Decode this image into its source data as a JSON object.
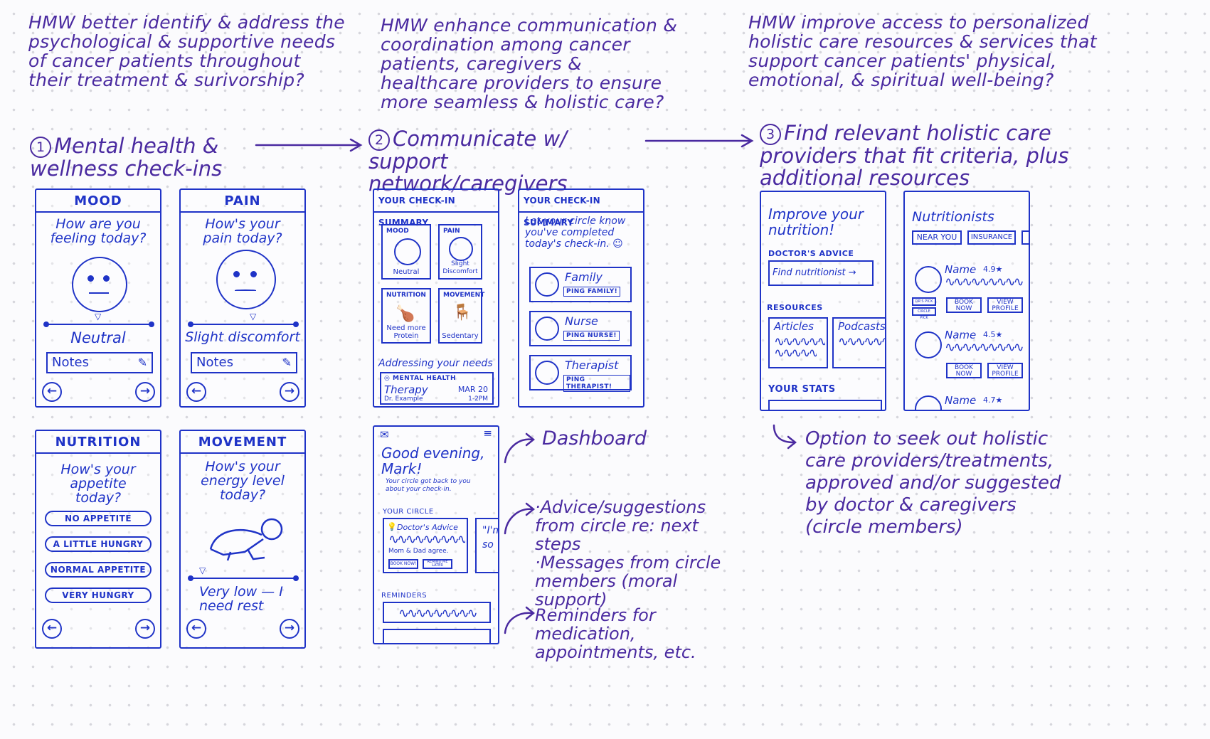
{
  "hmw": [
    "HMW better identify & address the psychological & supportive needs of cancer patients throughout their treatment & surivorship?",
    "HMW enhance communication & coordination among cancer patients, caregivers & healthcare providers to ensure more seamless & holistic care?",
    "HMW improve access to personalized holistic care resources & services that support cancer patients' physical, emotional, & spiritual well-being?"
  ],
  "steps": [
    {
      "num": "1",
      "label": "Mental health & wellness check-ins"
    },
    {
      "num": "2",
      "label": "Communicate w/ support network/caregivers"
    },
    {
      "num": "3",
      "label": "Find relevant holistic care providers that fit criteria, plus additional resources"
    }
  ],
  "mood": {
    "header": "MOOD",
    "question": "How are you feeling today?",
    "value": "Neutral",
    "notes": "Notes"
  },
  "pain": {
    "header": "PAIN",
    "question": "How's your pain today?",
    "value": "Slight discomfort",
    "notes": "Notes"
  },
  "nutrition": {
    "header": "NUTRITION",
    "question": "How's your appetite today?",
    "options": [
      "NO APPETITE",
      "A LITTLE HUNGRY",
      "NORMAL APPETITE",
      "VERY HUNGRY"
    ]
  },
  "movement": {
    "header": "MOVEMENT",
    "question": "How's your energy level today?",
    "value": "Very low — I need rest"
  },
  "summary": {
    "header": "YOUR CHECK-IN SUMMARY",
    "tiles": [
      {
        "label": "MOOD",
        "value": "Neutral"
      },
      {
        "label": "PAIN",
        "value": "Slight Discomfort"
      },
      {
        "label": "NUTRITION",
        "value": "Need more Protein"
      },
      {
        "label": "MOVEMENT",
        "value": "Sedentary"
      }
    ],
    "addressing": "Addressing your needs",
    "tag": "MENTAL HEALTH",
    "appt_title": "Therapy",
    "appt_date": "MAR 20",
    "appt_doctor": "Dr. Example",
    "appt_time": "1-2PM"
  },
  "circle": {
    "header": "YOUR CHECK-IN SUMMARY",
    "message": "Let your circle know you've completed today's check-in.",
    "contacts": [
      {
        "name": "Family",
        "button": "PING FAMILY!"
      },
      {
        "name": "Nurse",
        "button": "PING NURSE!"
      },
      {
        "name": "Therapist",
        "button": "PING THERAPIST!"
      }
    ]
  },
  "dashboard": {
    "greeting": "Good evening, Mark!",
    "sub": "Your circle got back to you about your check-in.",
    "circle_label": "YOUR CIRCLE",
    "advice_title": "Doctor's Advice",
    "advice_from": "Mom & Dad agree.",
    "btn_book": "BOOK NOW!",
    "btn_remind": "REMIND ME LATER",
    "peek": "\"I'm so",
    "reminders_label": "REMINDERS"
  },
  "annotations": {
    "dashboard": "Dashboard",
    "advice": "·Advice/suggestions from circle re: next steps\n·Messages from circle members (moral support)",
    "reminders": "Reminders for medication, appointments, etc.",
    "option": "Option to seek out holistic care providers/treatments, approved and/or suggested by doctor & caregivers (circle members)"
  },
  "improve": {
    "title": "Improve your nutrition!",
    "doctors_advice": "DOCTOR'S ADVICE",
    "find_btn": "Find nutritionist →",
    "resources": "RESOURCES",
    "articles": "Articles",
    "podcasts": "Podcasts",
    "stats": "YOUR STATS"
  },
  "nutritionists": {
    "title": "Nutritionists",
    "filters": [
      "NEAR YOU",
      "INSURANCE"
    ],
    "providers": [
      {
        "name": "Name",
        "rating": "4.9★",
        "tags": [
          "DR'S PICK",
          "CIRCLE PICK"
        ]
      },
      {
        "name": "Name",
        "rating": "4.5★",
        "tags": []
      },
      {
        "name": "Name",
        "rating": "4.7★",
        "tags": []
      }
    ],
    "book": "BOOK NOW",
    "profile": "VIEW PROFILE"
  },
  "colors": {
    "ink_blue": "#1f33c7",
    "ink_purple": "#4a2aa0",
    "paper": "#fbfbfd"
  }
}
